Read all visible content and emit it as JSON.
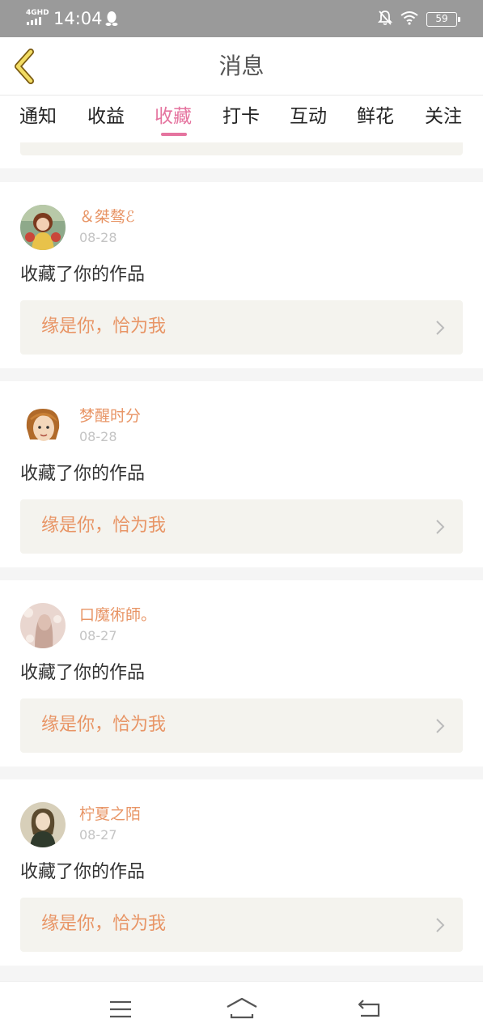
{
  "status_bar": {
    "network": "4GHD",
    "time": "14:04",
    "battery": "59"
  },
  "header": {
    "title": "消息"
  },
  "tabs": [
    {
      "label": "通知"
    },
    {
      "label": "收益"
    },
    {
      "label": "收藏",
      "active": true
    },
    {
      "label": "打卡"
    },
    {
      "label": "互动"
    },
    {
      "label": "鲜花"
    },
    {
      "label": "关注"
    }
  ],
  "messages": [
    {
      "username": "＆桀骜ℰ",
      "date": "08-28",
      "action": "收藏了你的作品",
      "work_title": "缘是你，恰为我",
      "avatar": "avatar-1-icon"
    },
    {
      "username": "梦醒时分",
      "date": "08-28",
      "action": "收藏了你的作品",
      "work_title": "缘是你，恰为我",
      "avatar": "avatar-2-icon"
    },
    {
      "username": "口魔術師。",
      "date": "08-27",
      "action": "收藏了你的作品",
      "work_title": "缘是你，恰为我",
      "avatar": "avatar-3-icon"
    },
    {
      "username": "柠夏之陌",
      "date": "08-27",
      "action": "收藏了你的作品",
      "work_title": "缘是你，恰为我",
      "avatar": "avatar-4-icon"
    }
  ],
  "colors": {
    "accent": "#e5749f",
    "username": "#e89566",
    "work_bg": "#f4f3ee",
    "status_bar": "#9a9a9a"
  }
}
